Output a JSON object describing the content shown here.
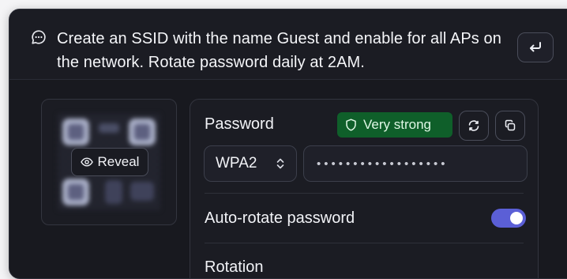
{
  "prompt": {
    "text": "Create an SSID with the name Guest and enable for all APs on the network. Rotate password daily at 2AM.",
    "chat_icon": "chat-bubble-icon",
    "submit_icon": "enter-return-icon"
  },
  "qr": {
    "reveal_label": "Reveal",
    "reveal_icon": "eye-icon"
  },
  "password": {
    "label": "Password",
    "strength_label": "Very strong",
    "strength_icon": "shield-icon",
    "strength_color": "#0f5f2a",
    "regenerate_icon": "refresh-icon",
    "copy_icon": "copy-icon",
    "security_mode": "WPA2",
    "masked_value": "••••••••••••••••••"
  },
  "auto_rotate": {
    "label": "Auto-rotate password",
    "enabled": true,
    "accent_color": "#5b5fd6"
  },
  "rotation": {
    "label": "Rotation"
  }
}
